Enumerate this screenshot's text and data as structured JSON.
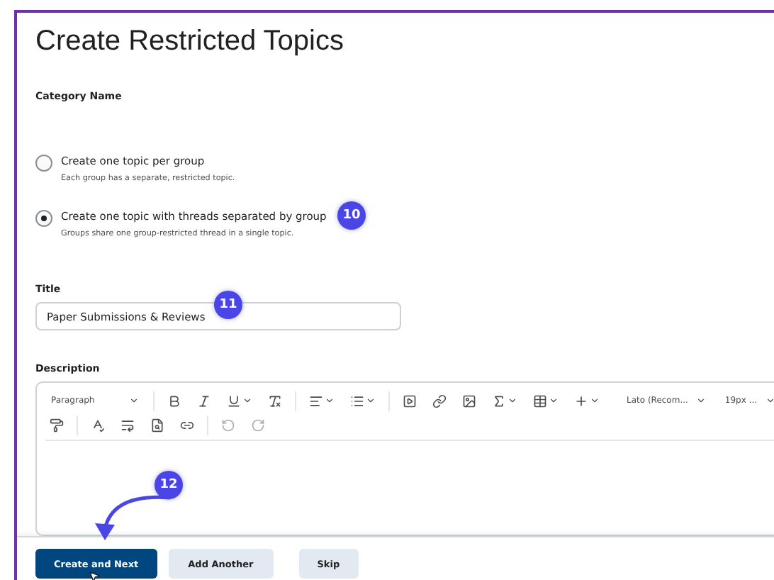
{
  "heading": "Create Restricted Topics",
  "category": {
    "label": "Category Name"
  },
  "options": [
    {
      "label": "Create one topic per group",
      "hint": "Each group has a separate, restricted topic.",
      "selected": false
    },
    {
      "label": "Create one topic with threads separated by group",
      "hint": "Groups share one group-restricted thread in a single topic.",
      "selected": true,
      "badge": "10"
    }
  ],
  "title_field": {
    "label": "Title",
    "value": "Paper Submissions & Reviews",
    "badge": "11"
  },
  "description": {
    "label": "Description",
    "toolbar": [
      [
        [
          {
            "kind": "select",
            "label": "Paragraph"
          }
        ],
        [
          {
            "kind": "icon"
          },
          {
            "kind": "icon"
          },
          {
            "kind": "icon",
            "menu": true
          },
          {
            "kind": "icon"
          }
        ],
        [
          {
            "kind": "icon",
            "menu": true
          },
          {
            "kind": "icon",
            "menu": true
          }
        ],
        [
          {
            "kind": "icon"
          },
          {
            "kind": "icon"
          },
          {
            "kind": "icon"
          },
          {
            "kind": "icon",
            "menu": true
          },
          {
            "kind": "icon",
            "menu": true
          },
          {
            "kind": "icon",
            "menu": true
          }
        ],
        [
          {
            "kind": "select",
            "label": "Lato (Recom..."
          },
          {
            "kind": "select",
            "label": "19px ..."
          }
        ]
      ],
      [
        [
          {
            "kind": "icon"
          }
        ],
        [
          {
            "kind": "icon"
          },
          {
            "kind": "icon"
          },
          {
            "kind": "icon"
          },
          {
            "kind": "icon"
          }
        ],
        [
          {
            "kind": "icon",
            "disabled": true
          },
          {
            "kind": "icon",
            "disabled": true
          }
        ]
      ]
    ]
  },
  "callout": {
    "badge": "12"
  },
  "buttons": [
    {
      "label": "Create and Next",
      "kind": "primary"
    },
    {
      "label": "Add Another",
      "kind": "secondary"
    },
    {
      "label": "Skip",
      "kind": "secondary"
    }
  ]
}
